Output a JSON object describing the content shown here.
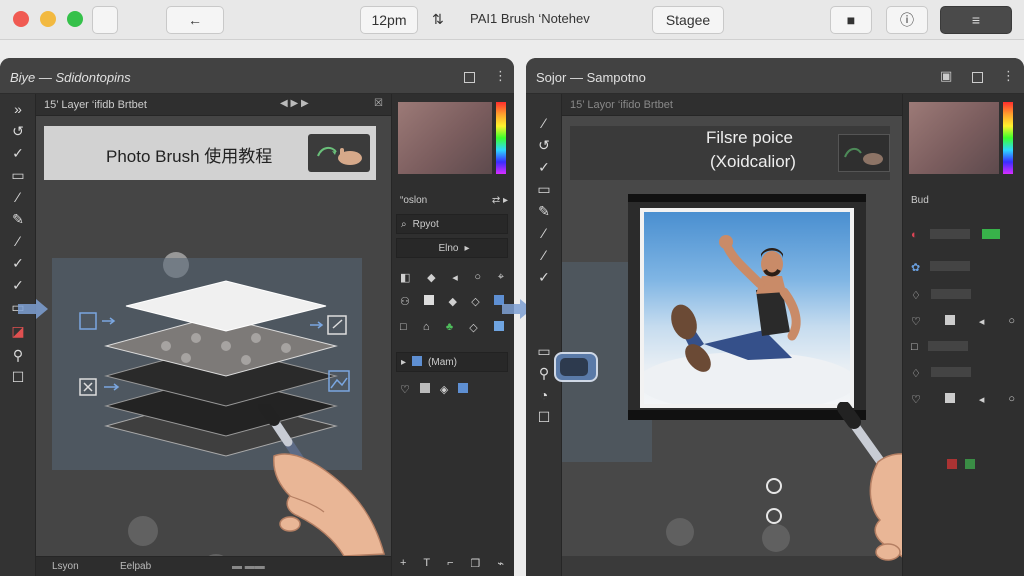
{
  "top_bar": {
    "back_button": "←",
    "zoom": "12pm",
    "title": "PAI1 Brush ‘Notehev",
    "stage_button": "Stagee",
    "right_button_3": "ⓘ",
    "right_button_4": "≡"
  },
  "left_panel": {
    "title": "Biye — Sdidontopins",
    "doc_tab": "15’ Layer ‘ifidb Brtbet",
    "banner_text": "Photo Brush 使用教程",
    "right_rows": {
      "row1": "“oslon",
      "row2": "Rpyot",
      "row3": "Elno",
      "row4": "(Mam)"
    },
    "status": {
      "item1": "Lsyon",
      "item2": "Eelpab"
    }
  },
  "right_panel": {
    "title": "Sojor — Sampotno",
    "doc_tab": "15’ Layor ‘ifido Brtbet",
    "float_line1": "Filsre poice",
    "float_line2": "(Xoidcalior)",
    "right_rows": {
      "row1": "Bud"
    }
  },
  "colors": {
    "panel_bg": "#3a3a3a",
    "accent_blue": "#6f95c9"
  }
}
